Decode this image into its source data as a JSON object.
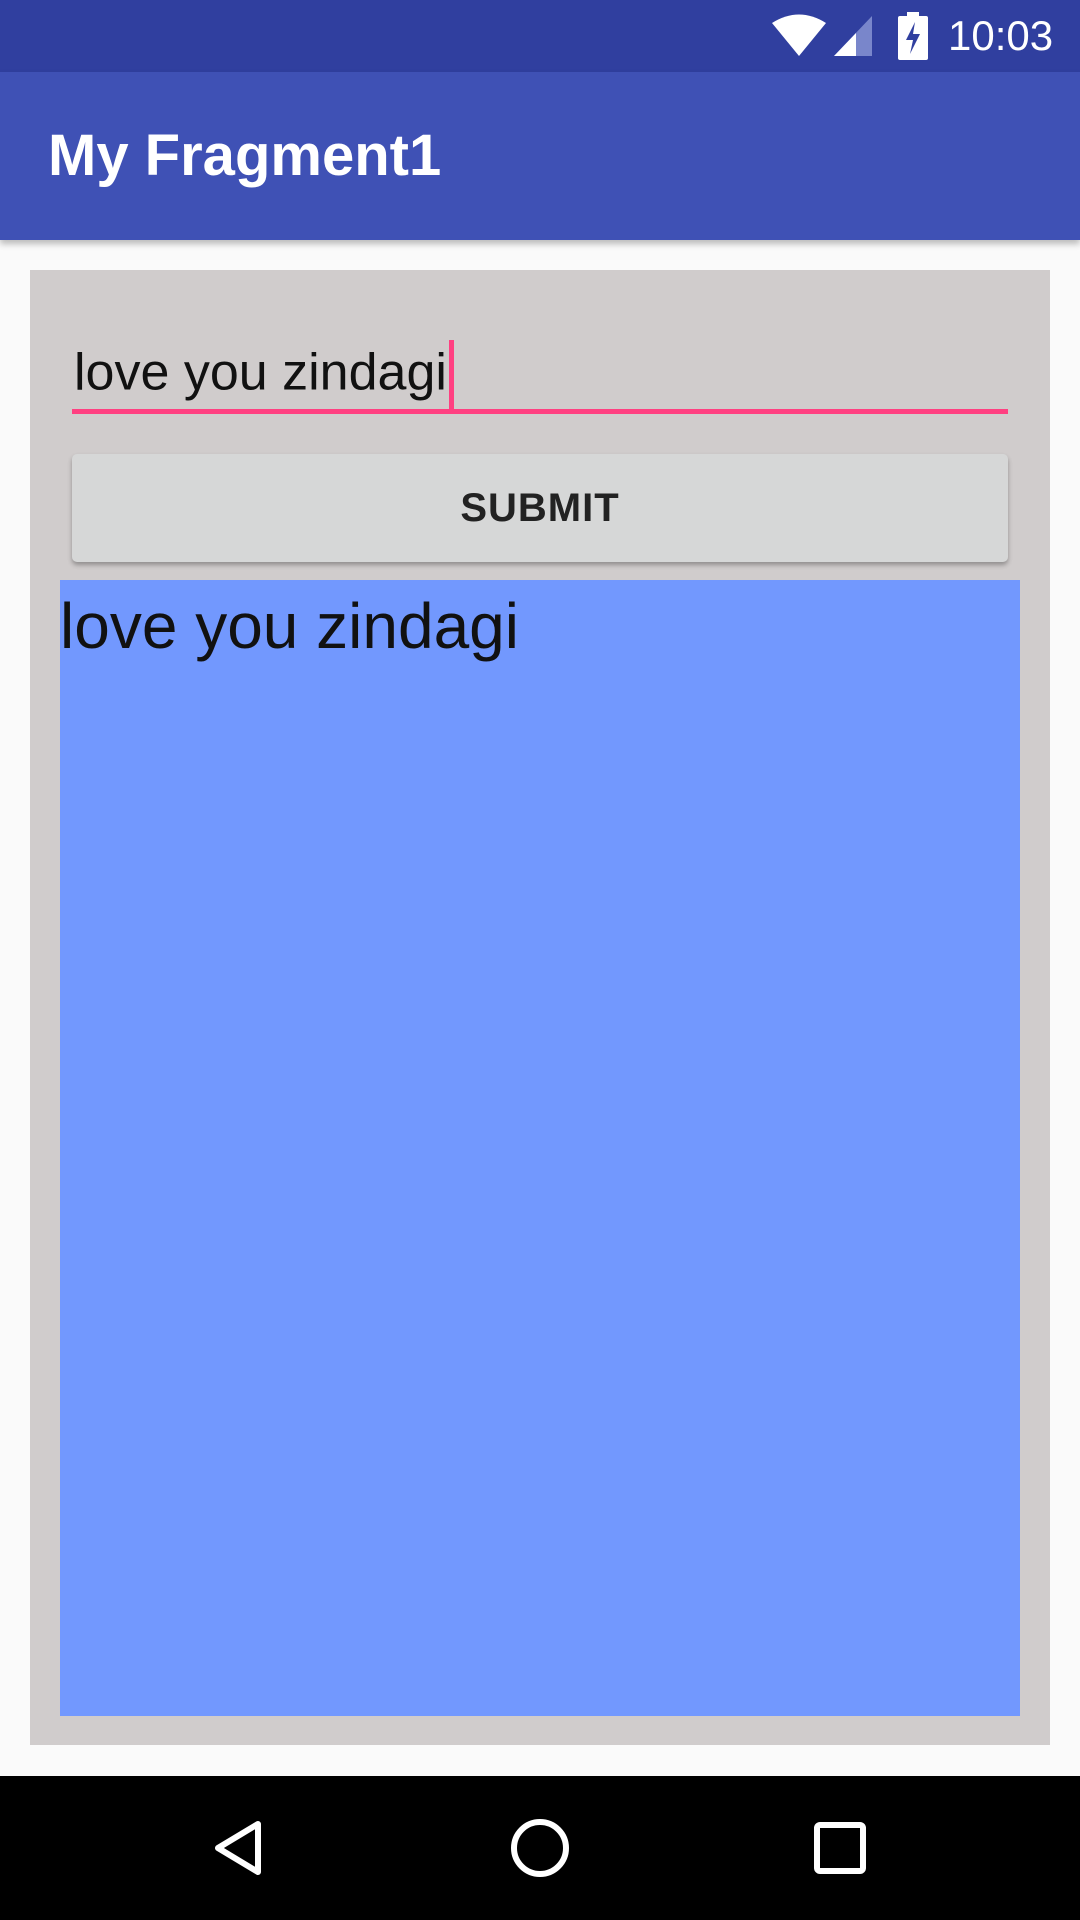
{
  "status_bar": {
    "time": "10:03",
    "icons": [
      "wifi-icon",
      "signal-icon",
      "battery-charging-icon"
    ],
    "background": "#303f9f"
  },
  "app_bar": {
    "title": "My Fragment1",
    "background": "#3f51b5"
  },
  "form": {
    "input_value": "love you zindagi",
    "accent": "#ff4081",
    "submit_label": "SUBMIT"
  },
  "display": {
    "text": "love you zindagi",
    "background": "#7298fe"
  },
  "nav_bar": {
    "buttons": [
      "back-icon",
      "home-icon",
      "recents-icon"
    ]
  }
}
